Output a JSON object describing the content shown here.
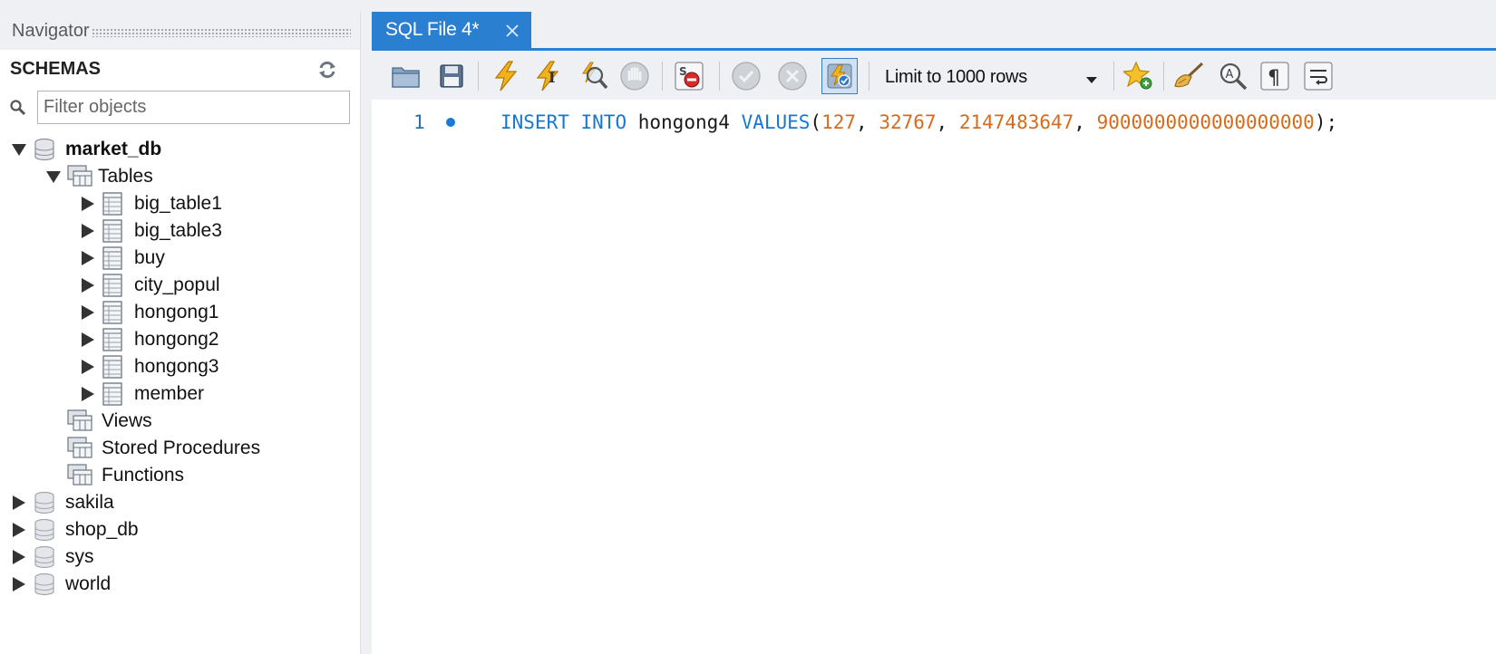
{
  "navigator": {
    "title": "Navigator",
    "schemas_label": "SCHEMAS",
    "filter_placeholder": "Filter objects",
    "schemas": [
      {
        "name": "market_db",
        "expanded": true,
        "folders": {
          "tables_label": "Tables",
          "tables": [
            "big_table1",
            "big_table3",
            "buy",
            "city_popul",
            "hongong1",
            "hongong2",
            "hongong3",
            "member"
          ],
          "views_label": "Views",
          "procedures_label": "Stored Procedures",
          "functions_label": "Functions"
        }
      },
      {
        "name": "sakila",
        "expanded": false
      },
      {
        "name": "shop_db",
        "expanded": false
      },
      {
        "name": "sys",
        "expanded": false
      },
      {
        "name": "world",
        "expanded": false
      }
    ]
  },
  "tab": {
    "label": "SQL File 4*"
  },
  "toolbar": {
    "limit_label": "Limit to 1000 rows"
  },
  "editor": {
    "line_number": "1",
    "tokens": {
      "kw1": "INSERT",
      "kw2": "INTO",
      "table": "hongong4",
      "kw3": "VALUES",
      "open": "(",
      "n1": "127",
      "n2": "32767",
      "n3": "2147483647",
      "n4": "9000000000000000000",
      "close": ");",
      "comma": ","
    }
  },
  "colors": {
    "accent": "#2a7fd0",
    "keyword": "#1478d4",
    "number": "#d86a1a"
  }
}
